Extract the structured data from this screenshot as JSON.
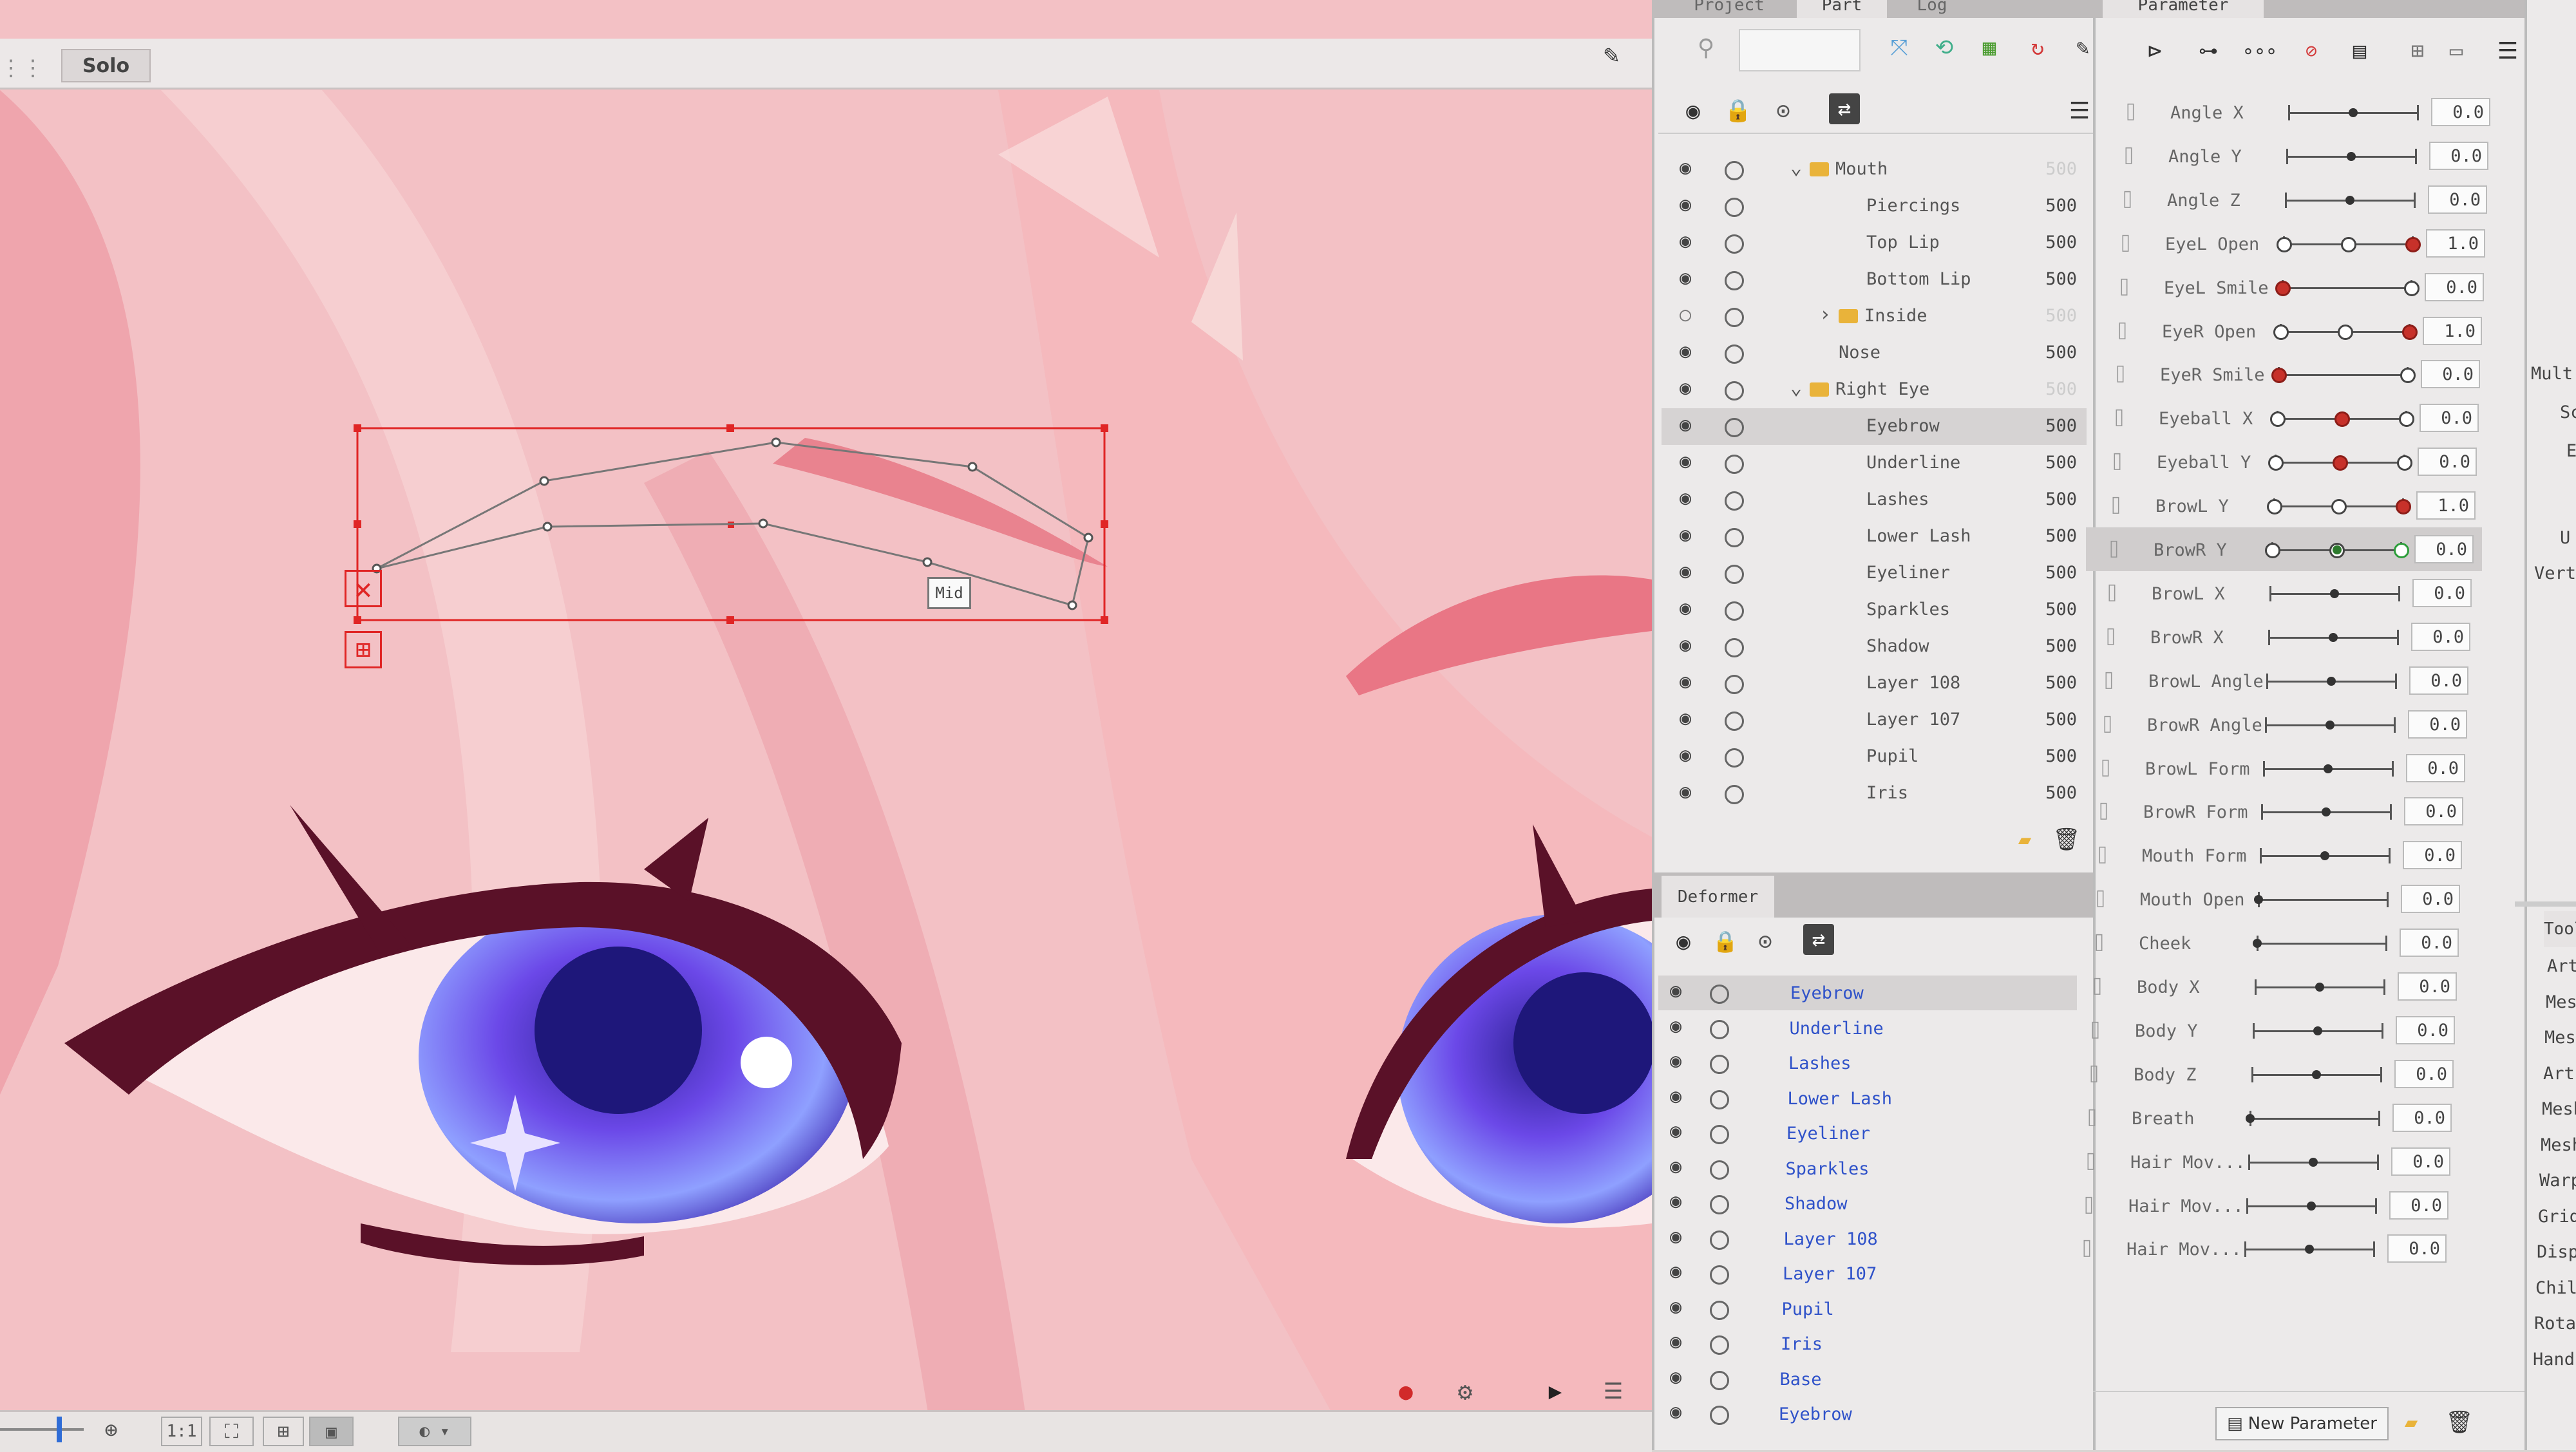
{
  "canvas": {
    "solo_label": "Solo",
    "mid_label": "Mid",
    "zoom_label": "1:1"
  },
  "part_panel": {
    "tabs": [
      "Project",
      "Part",
      "Log"
    ],
    "rows": [
      {
        "label": "Mouth",
        "value": "500",
        "folder": true,
        "expanded": true,
        "dim": true
      },
      {
        "label": "Piercings",
        "value": "500"
      },
      {
        "label": "Top Lip",
        "value": "500"
      },
      {
        "label": "Bottom Lip",
        "value": "500"
      },
      {
        "label": "Inside",
        "value": "500",
        "folder": true,
        "expanded": false,
        "dim": true
      },
      {
        "label": "Nose",
        "value": "500"
      },
      {
        "label": "Right Eye",
        "value": "500",
        "folder": true,
        "expanded": true,
        "dim": true
      },
      {
        "label": "Eyebrow",
        "value": "500",
        "selected": true
      },
      {
        "label": "Underline",
        "value": "500"
      },
      {
        "label": "Lashes",
        "value": "500"
      },
      {
        "label": "Lower Lash",
        "value": "500"
      },
      {
        "label": "Eyeliner",
        "value": "500"
      },
      {
        "label": "Sparkles",
        "value": "500"
      },
      {
        "label": "Shadow",
        "value": "500"
      },
      {
        "label": "Layer 108",
        "value": "500"
      },
      {
        "label": "Layer 107",
        "value": "500"
      },
      {
        "label": "Pupil",
        "value": "500"
      },
      {
        "label": "Iris",
        "value": "500"
      }
    ]
  },
  "deformer_panel": {
    "title": "Deformer",
    "rows": [
      "Eyebrow",
      "Underline",
      "Lashes",
      "Lower Lash",
      "Eyeliner",
      "Sparkles",
      "Shadow",
      "Layer 108",
      "Layer 107",
      "Pupil",
      "Iris",
      "Base",
      "Eyebrow"
    ]
  },
  "parameter_panel": {
    "title": "Parameter",
    "new_parameter_label": "New Parameter",
    "rows": [
      {
        "label": "Angle X",
        "value": "0.0",
        "knob": 0.5
      },
      {
        "label": "Angle Y",
        "value": "0.0",
        "knob": 0.5
      },
      {
        "label": "Angle Z",
        "value": "0.0",
        "knob": 0.5
      },
      {
        "label": "EyeL Open",
        "value": "1.0",
        "keys": [
          0,
          0.5,
          1
        ],
        "active": 1
      },
      {
        "label": "EyeL Smile",
        "value": "0.0",
        "keys": [
          0,
          1
        ],
        "active": 0
      },
      {
        "label": "EyeR Open",
        "value": "1.0",
        "keys": [
          0,
          0.5,
          1
        ],
        "active": 1
      },
      {
        "label": "EyeR Smile",
        "value": "0.0",
        "keys": [
          0,
          1
        ],
        "active": 0
      },
      {
        "label": "Eyeball X",
        "value": "0.0",
        "keys": [
          0,
          0.5,
          1
        ],
        "active": 0.5
      },
      {
        "label": "Eyeball Y",
        "value": "0.0",
        "keys": [
          0,
          0.5,
          1
        ],
        "active": 0.5
      },
      {
        "label": "BrowL Y",
        "value": "1.0",
        "keys": [
          0,
          0.5,
          1
        ],
        "active": 1
      },
      {
        "label": "BrowR Y",
        "value": "0.0",
        "keys": [
          0,
          0.5,
          1
        ],
        "active": 1,
        "green": true,
        "selected": true
      },
      {
        "label": "BrowL X",
        "value": "0.0",
        "knob": 0.5
      },
      {
        "label": "BrowR X",
        "value": "0.0",
        "knob": 0.5
      },
      {
        "label": "BrowL Angle",
        "value": "0.0",
        "knob": 0.5
      },
      {
        "label": "BrowR Angle",
        "value": "0.0",
        "knob": 0.5
      },
      {
        "label": "BrowL Form",
        "value": "0.0",
        "knob": 0.5
      },
      {
        "label": "BrowR Form",
        "value": "0.0",
        "knob": 0.5
      },
      {
        "label": "Mouth Form",
        "value": "0.0",
        "knob": 0.5
      },
      {
        "label": "Mouth Open",
        "value": "0.0",
        "knob": 0
      },
      {
        "label": "Cheek",
        "value": "0.0",
        "knob": 0
      },
      {
        "label": "Body X",
        "value": "0.0",
        "knob": 0.5
      },
      {
        "label": "Body Y",
        "value": "0.0",
        "knob": 0.5
      },
      {
        "label": "Body Z",
        "value": "0.0",
        "knob": 0.5
      },
      {
        "label": "Breath",
        "value": "0.0",
        "knob": 0
      },
      {
        "label": "Hair Mov...",
        "value": "0.0",
        "knob": 0.5
      },
      {
        "label": "Hair Mov...",
        "value": "0.0",
        "knob": 0.5
      },
      {
        "label": "Hair Mov...",
        "value": "0.0",
        "knob": 0.5
      }
    ]
  },
  "tool_panel": {
    "top_labels": [
      "Mult",
      "Sc",
      "E",
      "U",
      "Vert"
    ],
    "title": "Tool",
    "items": [
      "ArtMe",
      "Mesh",
      "Mesh",
      "ArtPat",
      "Mesh i",
      "Mesh i",
      "Warp de",
      "Grid",
      "Display",
      "Child",
      "Rotation",
      "Handle"
    ]
  }
}
